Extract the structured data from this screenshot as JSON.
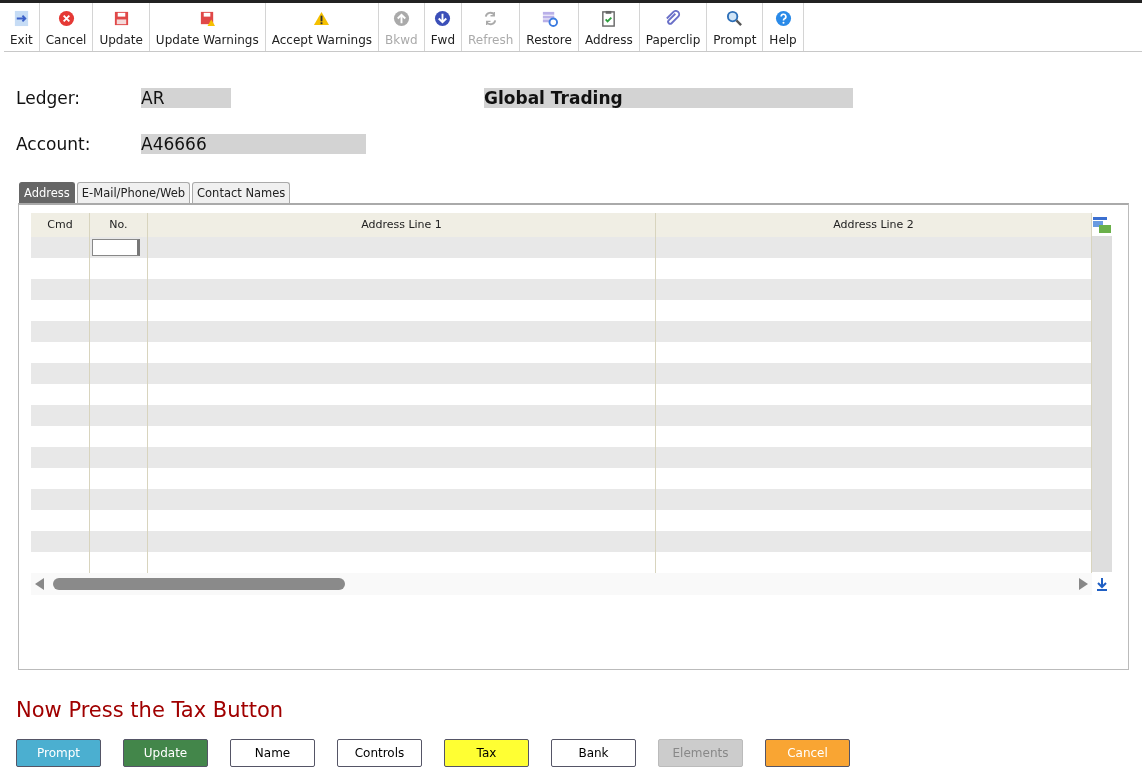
{
  "toolbar": [
    {
      "label": "Exit",
      "disabled": false
    },
    {
      "label": "Cancel",
      "disabled": false
    },
    {
      "label": "Update",
      "disabled": false
    },
    {
      "label": "Update Warnings",
      "disabled": false
    },
    {
      "label": "Accept Warnings",
      "disabled": false
    },
    {
      "label": "Bkwd",
      "disabled": true
    },
    {
      "label": "Fwd",
      "disabled": false
    },
    {
      "label": "Refresh",
      "disabled": true
    },
    {
      "label": "Restore",
      "disabled": false
    },
    {
      "label": "Address",
      "disabled": false
    },
    {
      "label": "Paperclip",
      "disabled": false
    },
    {
      "label": "Prompt",
      "disabled": false
    },
    {
      "label": "Help",
      "disabled": false
    }
  ],
  "header": {
    "ledger_label": "Ledger:",
    "ledger": "AR",
    "ledger_name": "Global Trading",
    "account_label": "Account:",
    "account": "A46666"
  },
  "tabs": [
    {
      "label": "Address",
      "selected": true
    },
    {
      "label": "E-Mail/Phone/Web",
      "selected": false
    },
    {
      "label": "Contact Names",
      "selected": false
    }
  ],
  "grid": {
    "columns": [
      "Cmd",
      "No.",
      "Address Line 1",
      "Address Line 2"
    ]
  },
  "instruction": "Now Press the Tax Button",
  "buttons": [
    {
      "label": "Prompt",
      "color": "#4bafd0",
      "disabled": false
    },
    {
      "label": "Update",
      "color": "#43864a",
      "disabled": false
    },
    {
      "label": "Name",
      "color": "#ffffff",
      "disabled": false
    },
    {
      "label": "Controls",
      "color": "#ffffff",
      "disabled": false
    },
    {
      "label": "Tax",
      "color": "#ffff33",
      "disabled": false
    },
    {
      "label": "Bank",
      "color": "#ffffff",
      "disabled": false
    },
    {
      "label": "Elements",
      "color": "#cccccc",
      "disabled": true
    },
    {
      "label": "Cancel",
      "color": "#f9a533",
      "disabled": false
    }
  ]
}
